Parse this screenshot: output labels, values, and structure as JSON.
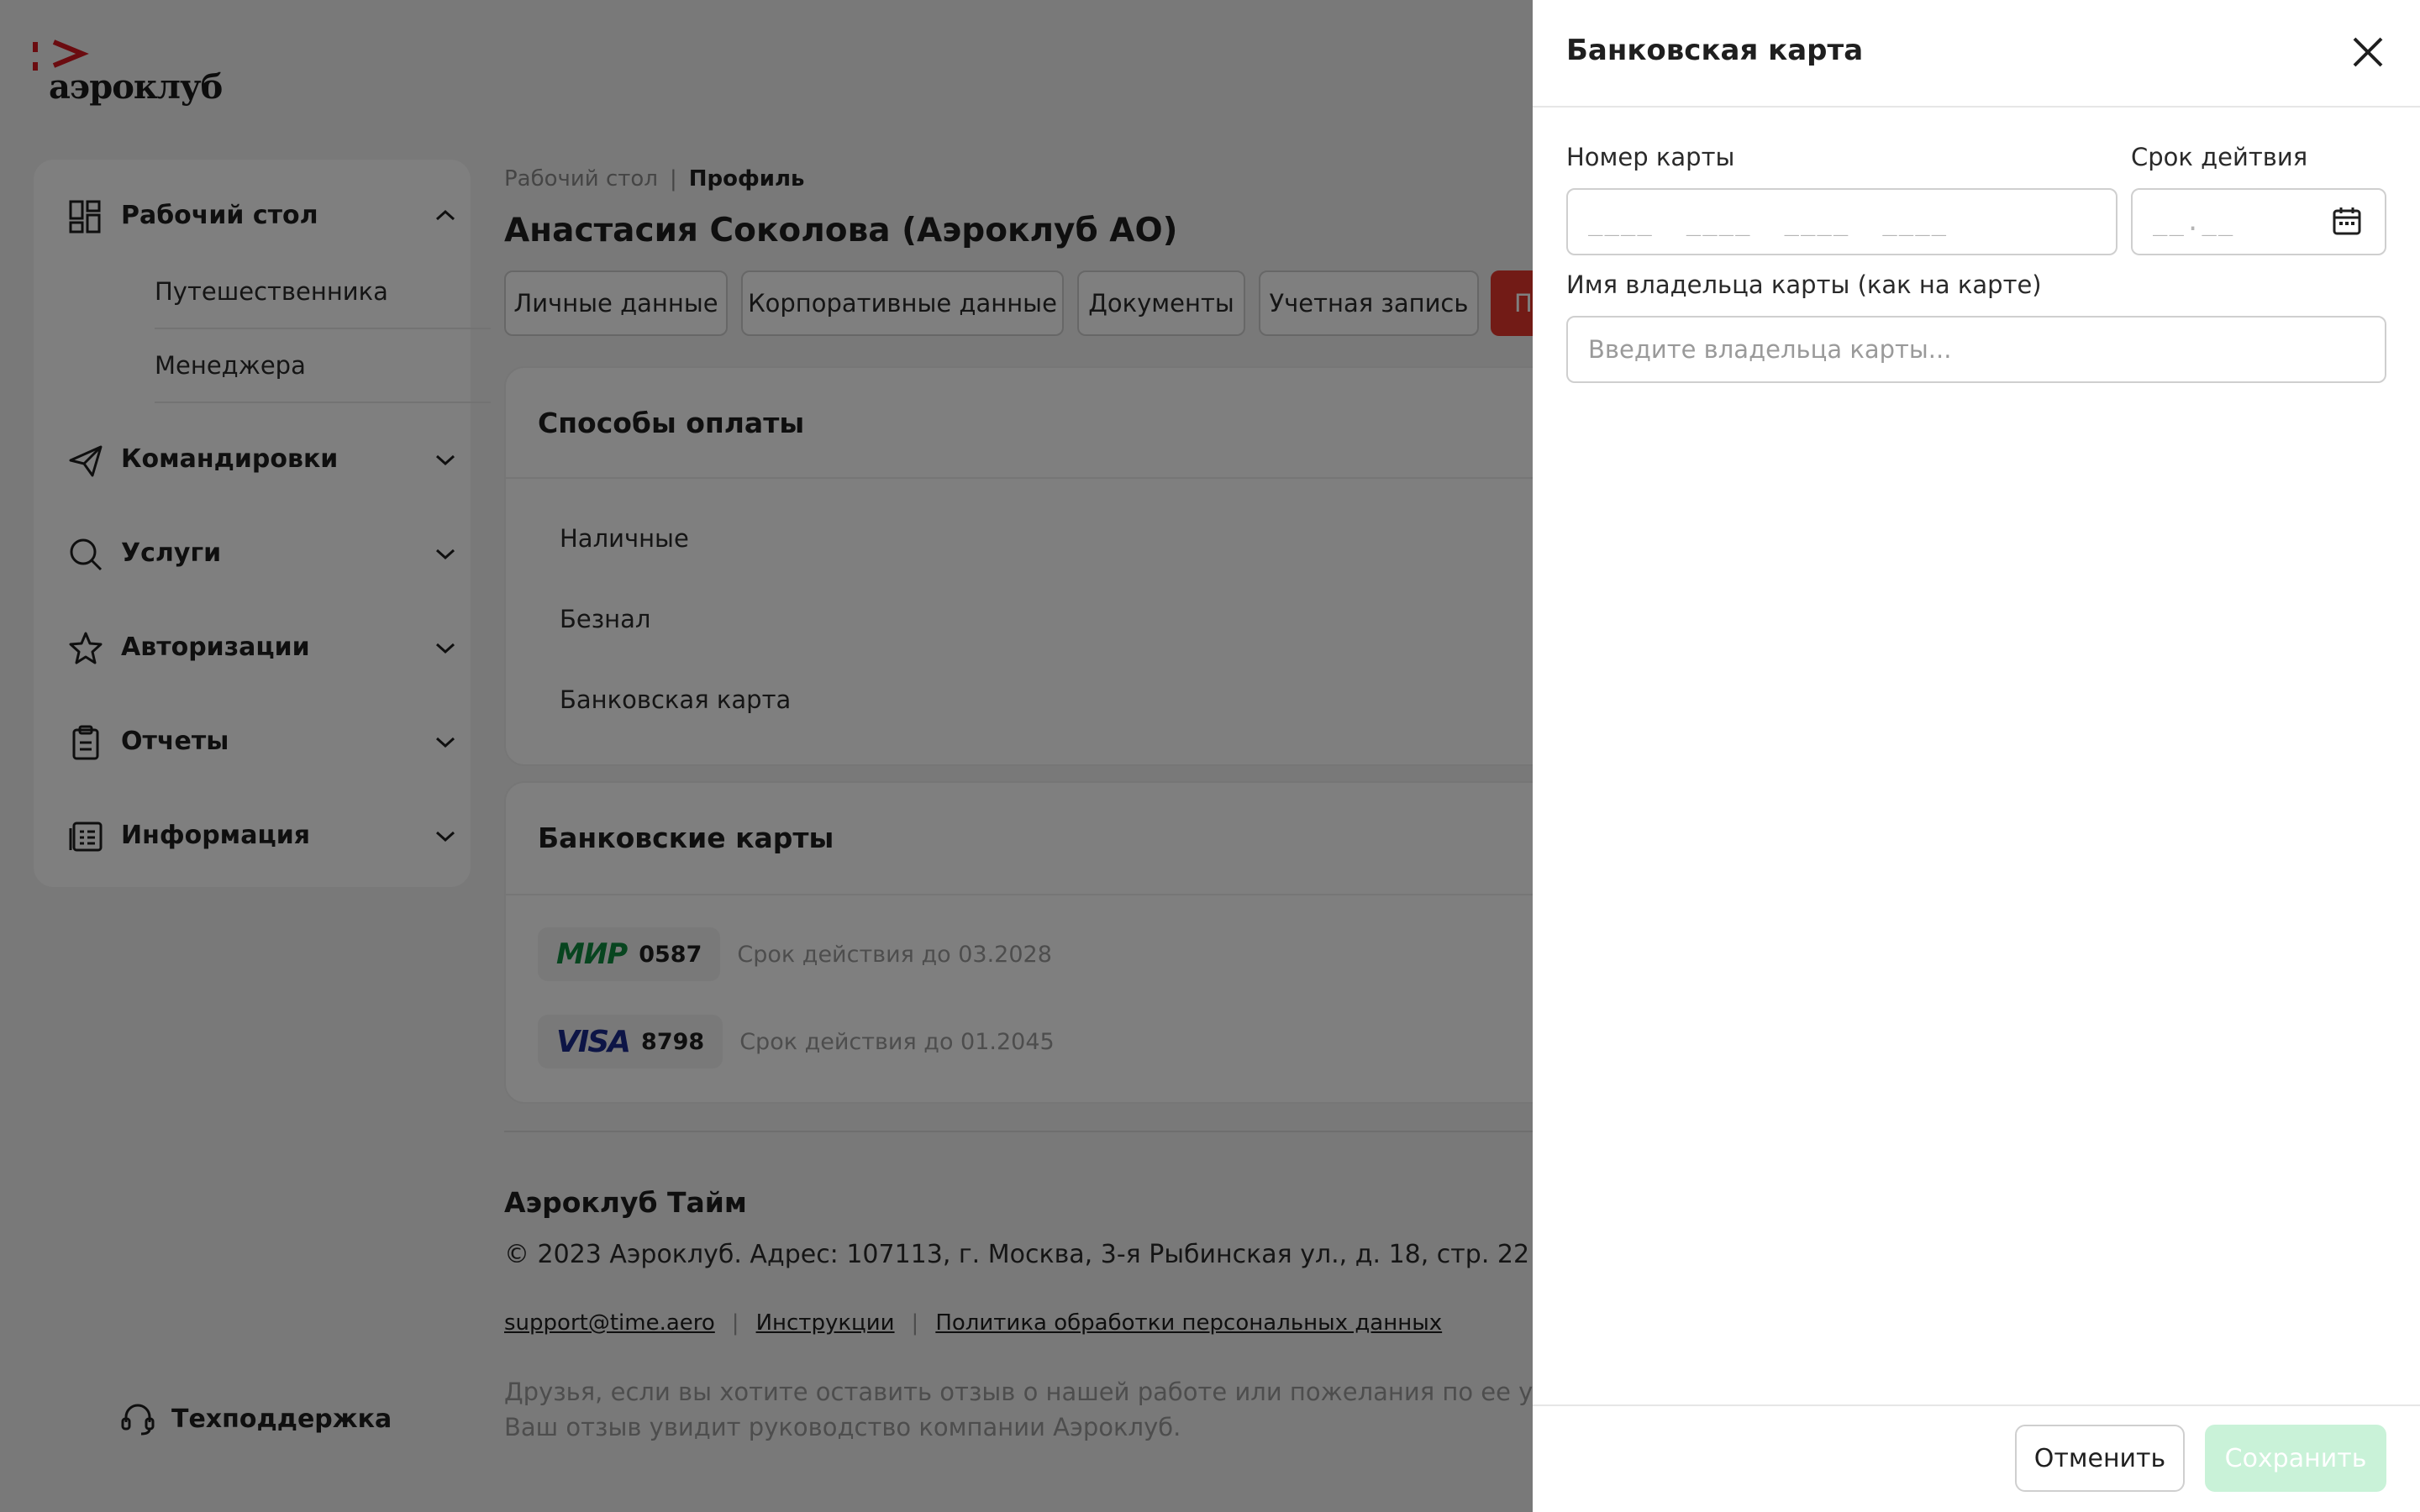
{
  "logo": {
    "text": "аэроклуб"
  },
  "sidebar": {
    "groups": [
      {
        "label": "Рабочий стол",
        "icon": "dashboard-icon",
        "expanded": true
      },
      {
        "label": "Командировки",
        "icon": "paper-plane-icon"
      },
      {
        "label": "Услуги",
        "icon": "search-icon"
      },
      {
        "label": "Авторизации",
        "icon": "star-icon"
      },
      {
        "label": "Отчеты",
        "icon": "clipboard-icon"
      },
      {
        "label": "Информация",
        "icon": "info-list-icon"
      }
    ],
    "subitems": [
      "Путешественника",
      "Менеджера"
    ],
    "support_label": "Техподдержка"
  },
  "breadcrumb": {
    "parent": "Рабочий стол",
    "separator": "|",
    "current": "Профиль"
  },
  "page_title": "Анастасия Соколова (Аэроклуб АО)",
  "tabs": [
    {
      "label": "Личные данные"
    },
    {
      "label": "Корпоративные данные"
    },
    {
      "label": "Документы"
    },
    {
      "label": "Учетная запись"
    },
    {
      "label": "П",
      "active": true
    }
  ],
  "payment_methods": {
    "title": "Способы оплаты",
    "items": [
      "Наличные",
      "Безнал",
      "Банковская карта"
    ]
  },
  "bank_cards": {
    "title": "Банковские карты",
    "items": [
      {
        "brand": "МИР",
        "last4": "0587",
        "expiry": "Срок действия до 03.2028"
      },
      {
        "brand": "VISA",
        "last4": "8798",
        "expiry": "Срок действия до 01.2045"
      }
    ]
  },
  "footer": {
    "title": "Аэроклуб Тайм",
    "address": "© 2023 Аэроклуб. Адрес: 107113, г. Москва, 3-я Рыбинская ул., д. 18, стр. 22",
    "links": [
      "support@time.aero",
      "Инструкции",
      "Политика обработки персональных данных"
    ],
    "separator": "|",
    "note_line1": "Друзья, если вы хотите оставить отзыв о нашей работе или пожелания по ее улучшению",
    "note_line2": "Ваш отзыв увидит руководство компании Аэроклуб."
  },
  "drawer": {
    "title": "Банковская карта",
    "card_number": {
      "label": "Номер  карты",
      "placeholder": "____  ____  ____  ____",
      "value": ""
    },
    "expiry": {
      "label": "Срок дейтвия",
      "placeholder": "__.__",
      "value": ""
    },
    "holder": {
      "label": "Имя владельца карты (как на карте)",
      "placeholder": "Введите владельца карты...",
      "value": ""
    },
    "cancel_label": "Отменить",
    "save_label": "Сохранить"
  },
  "colors": {
    "accent_red": "#e4372d",
    "save_disabled": "#c9f2d8",
    "mir_green": "#0f8a3e",
    "visa_blue": "#1a2a8c"
  }
}
